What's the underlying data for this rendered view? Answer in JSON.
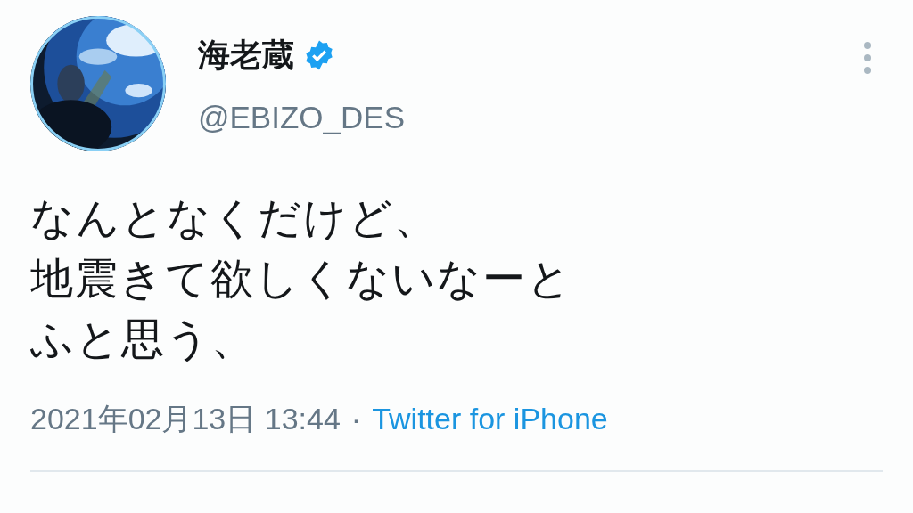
{
  "user": {
    "name": "海老蔵",
    "verified": true,
    "handle": "@EBIZO_DES"
  },
  "tweet": {
    "lines": [
      "なんとなくだけど、",
      "地震きて欲しくないなーと",
      "ふと思う、"
    ]
  },
  "meta": {
    "timestamp": "2021年02月13日 13:44",
    "separator": "·",
    "source": "Twitter for iPhone"
  }
}
